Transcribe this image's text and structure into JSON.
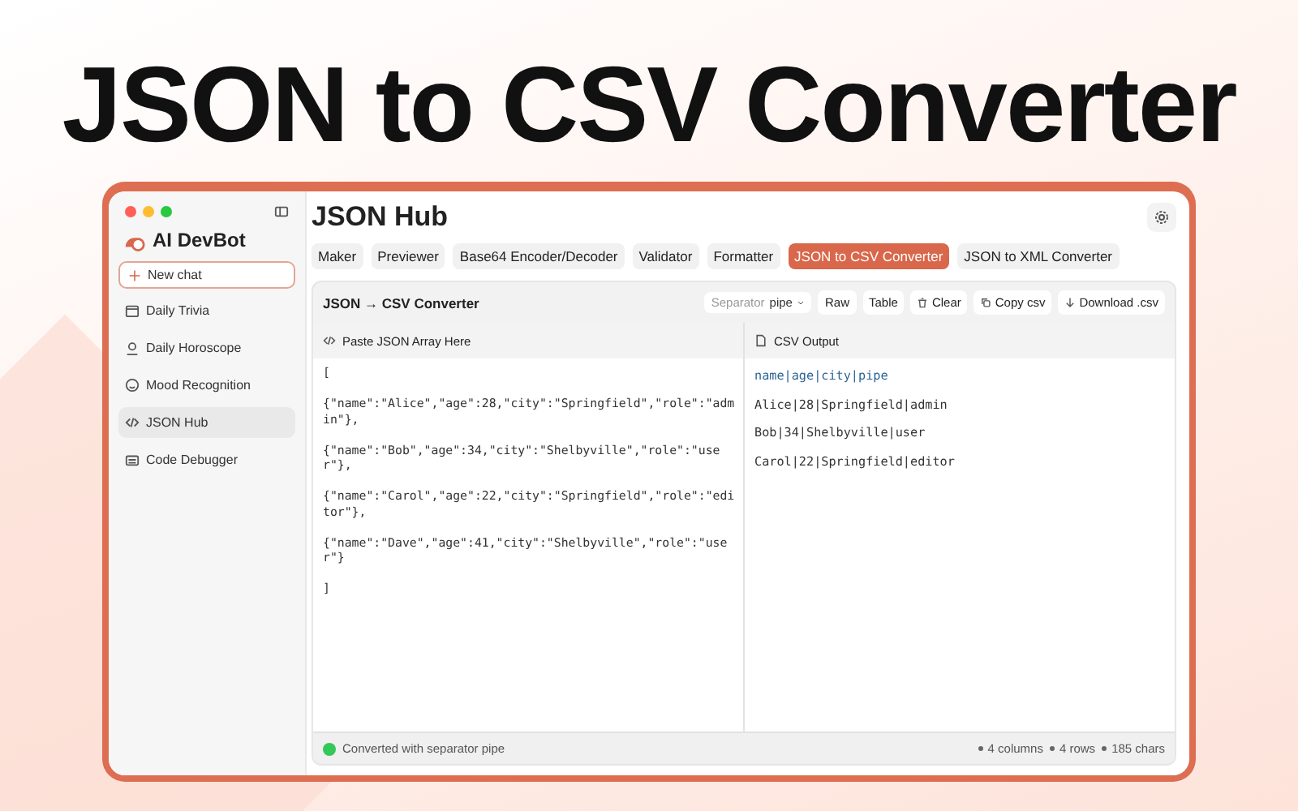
{
  "headline": "JSON to CSV Converter",
  "window": {
    "title": "JSON Hub"
  },
  "sidebar": {
    "brand": "AI DevBot",
    "new_chat": "New chat",
    "items": [
      {
        "label": "Daily Trivia",
        "selected": false
      },
      {
        "label": "Daily Horoscope",
        "selected": false
      },
      {
        "label": "Mood Recognition",
        "selected": false
      },
      {
        "label": "JSON Hub",
        "selected": true
      },
      {
        "label": "Code Debugger",
        "selected": false
      }
    ]
  },
  "tabs": [
    {
      "label": "Maker",
      "selected": false
    },
    {
      "label": "Previewer",
      "selected": false
    },
    {
      "label": "Base64 Encoder/Decoder",
      "selected": false
    },
    {
      "label": "Validator",
      "selected": false
    },
    {
      "label": "Formatter",
      "selected": false
    },
    {
      "label": "JSON to CSV Converter",
      "selected": true
    },
    {
      "label": "JSON to XML Converter",
      "selected": false
    }
  ],
  "toolbar": {
    "title": "JSON → CSV Converter",
    "separator_label": "Separator",
    "separator_value": "pipe",
    "buttons": [
      "Raw",
      "Table",
      "Clear",
      "Copy csv",
      "Download .csv"
    ]
  },
  "input": {
    "title": "Paste JSON Array Here",
    "lines": [
      "[",
      "{\"name\":\"Alice\",\"age\":28,\"city\":\"Springfield\",\"role\":\"admin\"},",
      "{\"name\":\"Bob\",\"age\":34,\"city\":\"Shelbyville\",\"role\":\"user\"},",
      "{\"name\":\"Carol\",\"age\":22,\"city\":\"Springfield\",\"role\":\"editor\"},",
      "{\"name\":\"Dave\",\"age\":41,\"city\":\"Shelbyville\",\"role\":\"user\"}",
      "]"
    ]
  },
  "output": {
    "title": "CSV Output",
    "header": "name|age|city|pipe",
    "rows": [
      "Alice|28|Springfield|admin",
      "Bob|34|Shelbyville|user",
      "Carol|22|Springfield|editor"
    ]
  },
  "status_bar": {
    "message": "Converted with separator pipe",
    "color": "#34c759",
    "stats": [
      "4 columns",
      "4 rows",
      "185 chars"
    ]
  }
}
